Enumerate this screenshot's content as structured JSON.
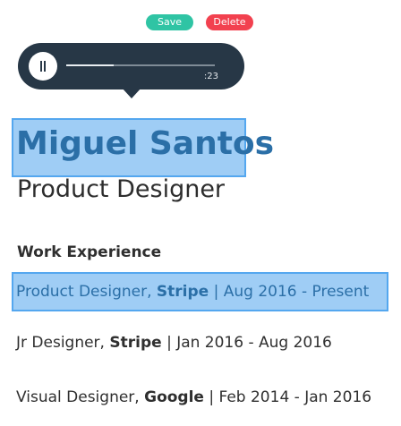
{
  "actions": {
    "save_label": "Save",
    "delete_label": "Delete"
  },
  "player": {
    "time": ":23",
    "progress": 0.32,
    "state": "playing",
    "icon": "pause-icon"
  },
  "profile": {
    "name": "Miguel Santos",
    "title": "Product Designer",
    "section_heading": "Work Experience",
    "experience": [
      {
        "role": "Product Designer,",
        "company": "Stripe",
        "dates": "| Aug 2016 - Present",
        "selected": true
      },
      {
        "role": "Jr Designer,",
        "company": "Stripe",
        "dates": "| Jan 2016 - Aug 2016",
        "selected": false
      },
      {
        "role": "Visual Designer,",
        "company": "Google",
        "dates": "| Feb 2014 - Jan 2016",
        "selected": false
      }
    ]
  },
  "colors": {
    "save": "#2fc4a4",
    "delete": "#f2414f",
    "player_bg": "#273746",
    "selection_fill": "#9fcdf5",
    "selection_border": "#54a7ef",
    "selected_text": "#2b6fa7"
  }
}
